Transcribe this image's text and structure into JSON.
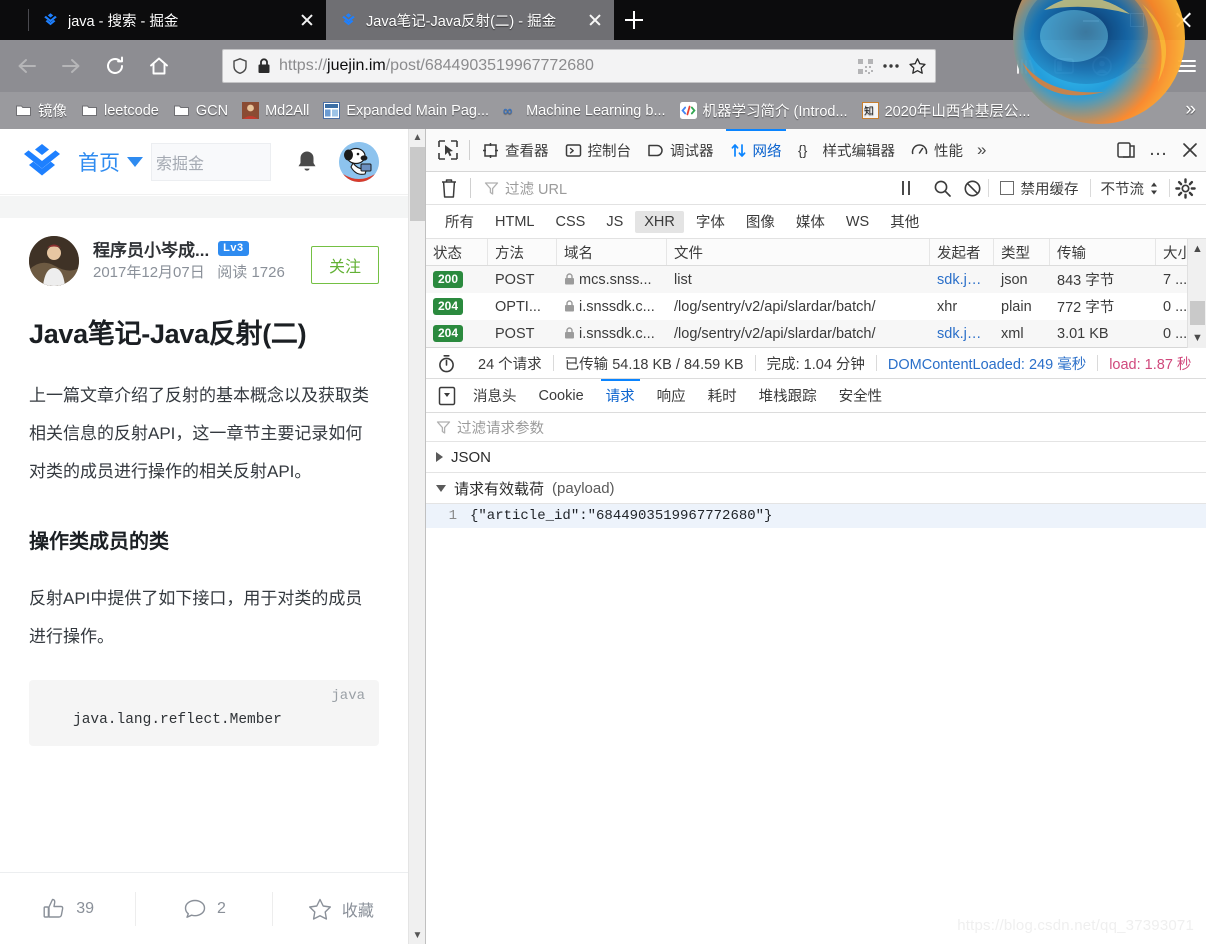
{
  "browser": {
    "tabs": [
      {
        "title": "java - 搜索 - 掘金",
        "active": false
      },
      {
        "title": "Java笔记-Java反射(二) - 掘金",
        "active": true
      }
    ],
    "new_tab_label": "+",
    "window_controls": {
      "minimize": "minimize-button",
      "maximize": "maximize-button",
      "close": "close-button"
    },
    "nav": {
      "back": "back-button",
      "forward": "forward-button",
      "reload": "reload-button",
      "home": "home-button"
    },
    "url": {
      "scheme": "https://",
      "host": "juejin.im",
      "path": "/post/6844903519967772680",
      "full": "https://juejin.im/post/6844903519967772680"
    },
    "bookmarks": [
      {
        "label": "镜像",
        "icon": "folder-icon"
      },
      {
        "label": "leetcode",
        "icon": "folder-icon"
      },
      {
        "label": "GCN",
        "icon": "folder-icon"
      },
      {
        "label": "Md2All",
        "icon": "site-icon"
      },
      {
        "label": "Expanded Main Pag...",
        "icon": "site-icon"
      },
      {
        "label": "Machine Learning b...",
        "icon": "site-icon"
      },
      {
        "label": "机器学习简介 (Introd...",
        "icon": "site-icon"
      },
      {
        "label": "2020年山西省基层公...",
        "icon": "site-icon"
      }
    ],
    "bookmarks_overflow": "»"
  },
  "page": {
    "header": {
      "logo": "juejin-logo",
      "home_label": "首页",
      "search_placeholder": "索掘金",
      "bell": "notifications-bell-icon",
      "avatar": "user-avatar"
    },
    "author": {
      "name": "程序员小岑成...",
      "level_badge": "Lv3",
      "date": "2017年12月07日",
      "reads_label": "阅读",
      "reads_count": "1726",
      "follow_label": "关注"
    },
    "article": {
      "title": "Java笔记-Java反射(二)",
      "paragraph1": "上一篇文章介绍了反射的基本概念以及获取类相关信息的反射API，这一章节主要记录如何对类的成员进行操作的相关反射API。",
      "heading2": "操作类成员的类",
      "paragraph2": "反射API中提供了如下接口，用于对类的成员进行操作。",
      "code_lang": "java",
      "code_text": "java.lang.reflect.Member"
    },
    "actions": {
      "like_count": "39",
      "comment_count": "2",
      "collect_label": "收藏"
    }
  },
  "devtools": {
    "toolbar": {
      "picker": "element-picker-icon",
      "tabs": [
        {
          "label": "查看器",
          "icon": "inspector-icon",
          "selected": false
        },
        {
          "label": "控制台",
          "icon": "console-icon",
          "selected": false
        },
        {
          "label": "调试器",
          "icon": "debugger-icon",
          "selected": false
        },
        {
          "label": "网络",
          "icon": "network-icon",
          "selected": true
        },
        {
          "label": "样式编辑器",
          "icon": "style-editor-icon",
          "selected": false
        },
        {
          "label": "性能",
          "icon": "performance-icon",
          "selected": false
        }
      ],
      "overflow": "»",
      "dock": "dock-toggle-icon",
      "meatball": "…",
      "close": "close-devtools-icon"
    },
    "filterbar": {
      "trash": "clear-requests-icon",
      "filter_placeholder": "过滤 URL",
      "pause": "pause-icon",
      "search": "search-icon",
      "block": "block-icon",
      "disable_cache_label": "禁用缓存",
      "disable_cache_checked": false,
      "throttle_label": "不节流",
      "settings": "settings-gear-icon"
    },
    "type_filters": [
      {
        "label": "所有",
        "on": false
      },
      {
        "label": "HTML",
        "on": false
      },
      {
        "label": "CSS",
        "on": false
      },
      {
        "label": "JS",
        "on": false
      },
      {
        "label": "XHR",
        "on": true
      },
      {
        "label": "字体",
        "on": false
      },
      {
        "label": "图像",
        "on": false
      },
      {
        "label": "媒体",
        "on": false
      },
      {
        "label": "WS",
        "on": false
      },
      {
        "label": "其他",
        "on": false
      }
    ],
    "table": {
      "columns": [
        "状态",
        "方法",
        "域名",
        "文件",
        "发起者",
        "类型",
        "传输",
        "大小"
      ],
      "rows": [
        {
          "status": "200",
          "method": "POST",
          "domain": "mcs.snss...",
          "file": "list",
          "initiator": "sdk.js:...",
          "type": "json",
          "transferred": "843 字节",
          "size": "7 ..."
        },
        {
          "status": "204",
          "method": "OPTI...",
          "domain": "i.snssdk.c...",
          "file": "/log/sentry/v2/api/slardar/batch/",
          "initiator": "xhr",
          "type": "plain",
          "transferred": "772 字节",
          "size": "0 ..."
        },
        {
          "status": "204",
          "method": "POST",
          "domain": "i.snssdk.c...",
          "file": "/log/sentry/v2/api/slardar/batch/",
          "initiator": "sdk.js:...",
          "type": "xml",
          "transferred": "3.01 KB",
          "size": "0 ..."
        }
      ]
    },
    "summary": {
      "clock_icon": "timer-icon",
      "requests": "24 个请求",
      "transferred": "已传输 54.18 KB / 84.59 KB",
      "finish": "完成: 1.04 分钟",
      "dom_content_loaded": "DOMContentLoaded: 249 毫秒",
      "load": "load: 1.87 秒"
    },
    "detail_tabs": [
      {
        "label": "消息头",
        "selected": false
      },
      {
        "label": "Cookie",
        "selected": false
      },
      {
        "label": "请求",
        "selected": true
      },
      {
        "label": "响应",
        "selected": false
      },
      {
        "label": "耗时",
        "selected": false
      },
      {
        "label": "堆栈跟踪",
        "selected": false
      },
      {
        "label": "安全性",
        "selected": false
      }
    ],
    "request_panel": {
      "filter_placeholder": "过滤请求参数",
      "json_section": "JSON",
      "payload_section": "请求有效载荷",
      "payload_note": "(payload)",
      "payload_line_number": "1",
      "payload_body": "{\"article_id\":\"6844903519967772680\"}"
    }
  },
  "watermark": "https://blog.csdn.net/qq_37393071",
  "colors": {
    "accent_blue": "#0a84ff",
    "link_blue": "#2a6fc9",
    "status_green": "#2b8a3e",
    "follow_green": "#62b135",
    "load_red": "#d0487c",
    "juejin_blue": "#2e8bf0"
  }
}
